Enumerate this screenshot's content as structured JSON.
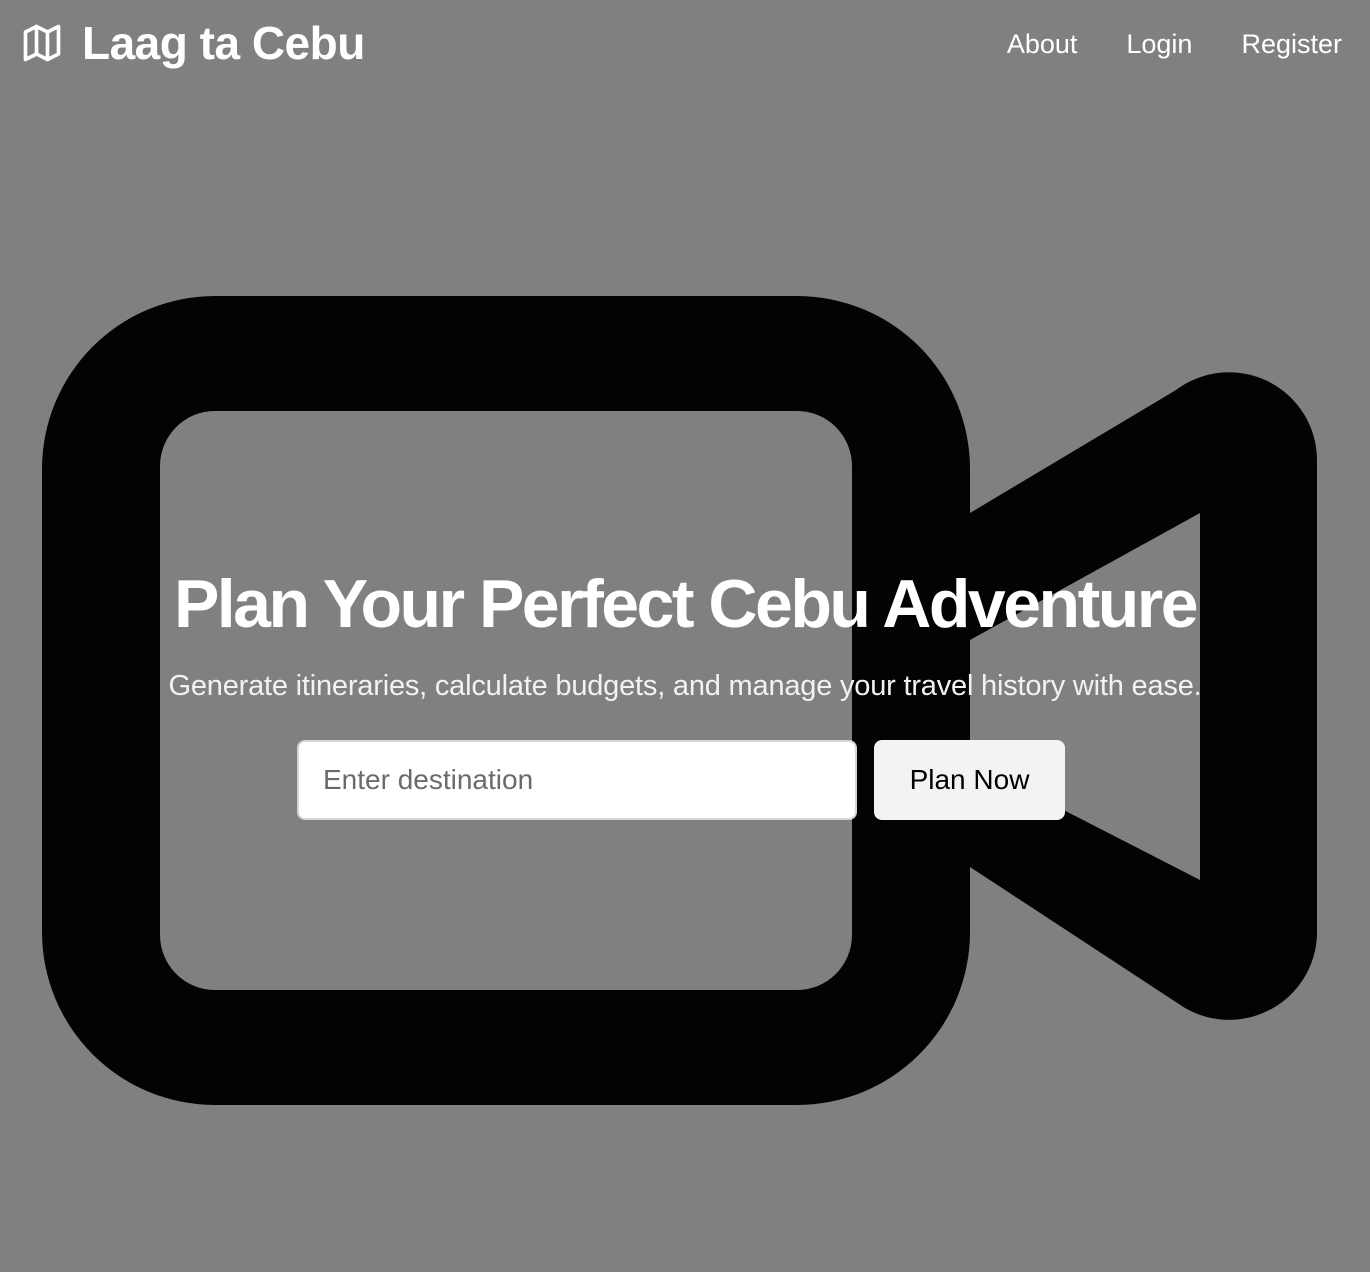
{
  "brand": {
    "title": "Laag ta Cebu",
    "icon": "map-icon"
  },
  "nav": {
    "items": [
      {
        "label": "About"
      },
      {
        "label": "Login"
      },
      {
        "label": "Register"
      }
    ]
  },
  "hero": {
    "background_icon": "video-camera-icon",
    "headline": "Plan Your Perfect Cebu Adventure",
    "subtitle": "Generate itineraries, calculate budgets, and manage your travel history with ease."
  },
  "search": {
    "placeholder": "Enter destination",
    "value": "",
    "button_label": "Plan Now"
  },
  "colors": {
    "background": "#808080",
    "text": "#ffffff",
    "icon": "#030303",
    "button_bg": "#f3f3f3",
    "input_bg": "#ffffff"
  }
}
